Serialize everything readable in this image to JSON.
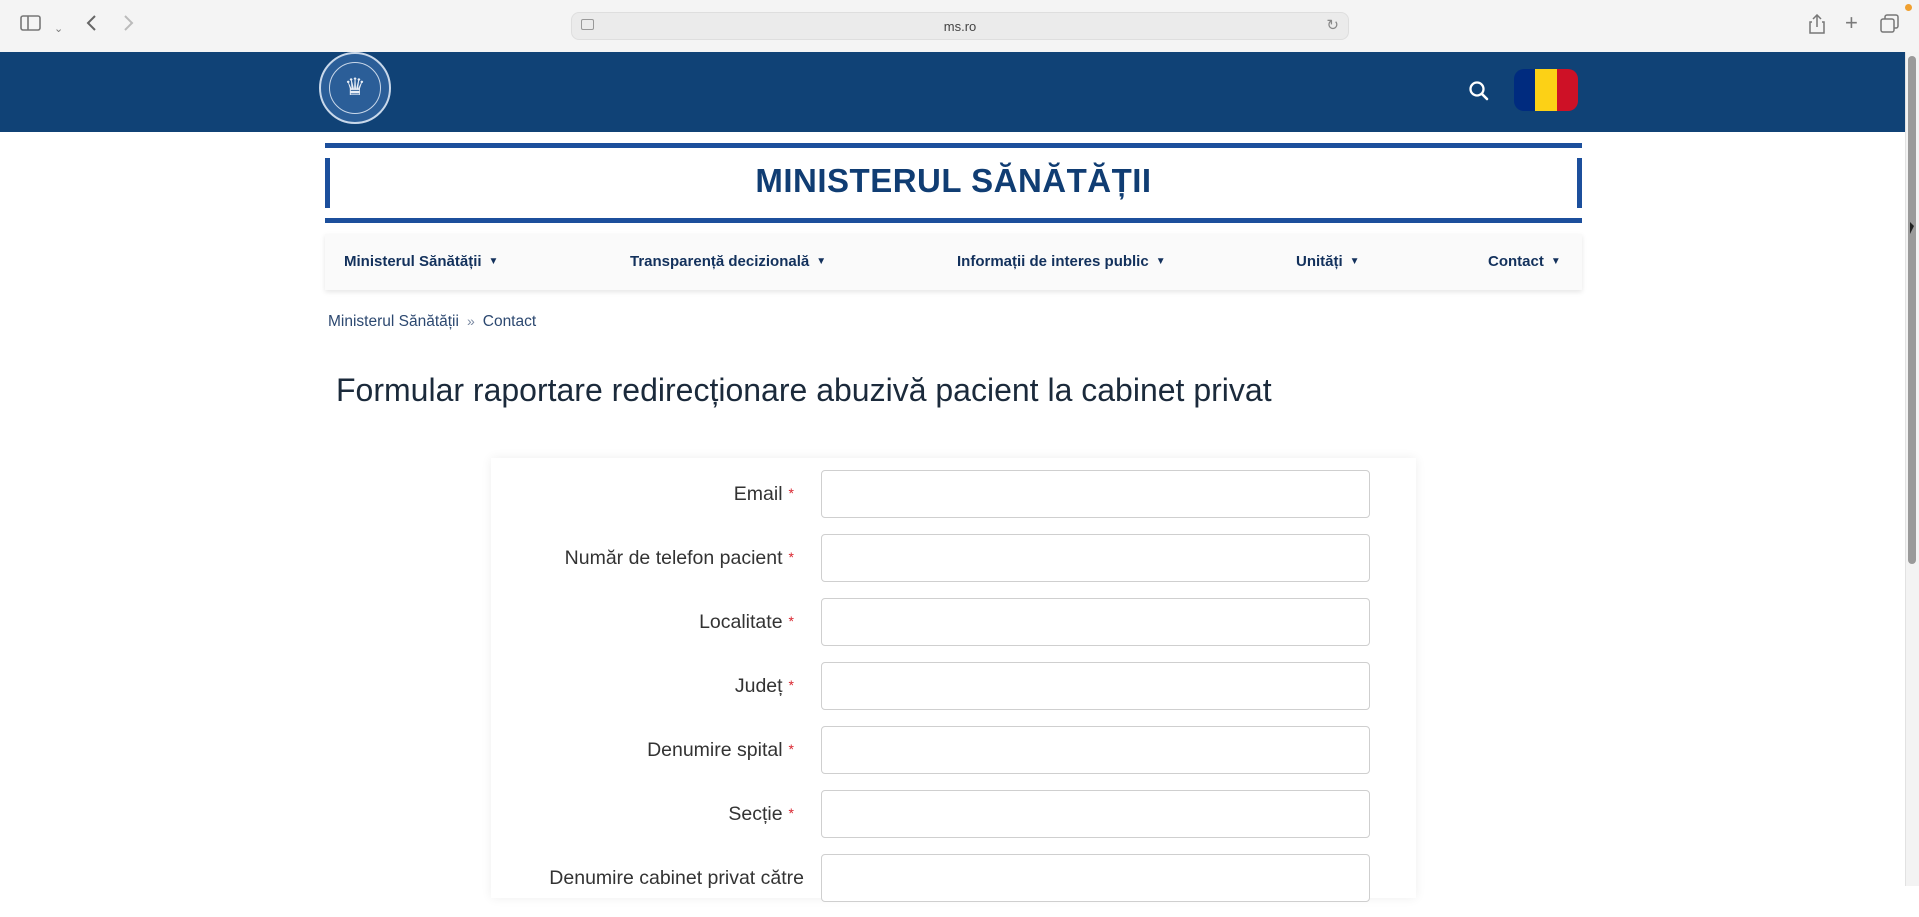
{
  "browser": {
    "url": "ms.ro"
  },
  "header": {
    "flag_colors": [
      "#002B7F",
      "#FCD116",
      "#CE1126"
    ],
    "background": "#104276"
  },
  "site": {
    "title": "MINISTERUL SĂNĂTĂȚII"
  },
  "nav": {
    "items": [
      {
        "label": "Ministerul Sănătății"
      },
      {
        "label": "Transparență decizională"
      },
      {
        "label": "Informații de interes public"
      },
      {
        "label": "Unități"
      },
      {
        "label": "Contact"
      }
    ]
  },
  "breadcrumb": {
    "items": [
      "Ministerul Sănătății",
      "Contact"
    ]
  },
  "page": {
    "title": "Formular raportare redirecționare abuzivă pacient la cabinet privat"
  },
  "form": {
    "required_mark": "*",
    "fields": [
      {
        "label": "Email",
        "value": ""
      },
      {
        "label": "Număr de telefon pacient",
        "value": ""
      },
      {
        "label": "Localitate",
        "value": ""
      },
      {
        "label": "Județ",
        "value": ""
      },
      {
        "label": "Denumire spital",
        "value": ""
      },
      {
        "label": "Secție",
        "value": ""
      },
      {
        "label": "Denumire cabinet privat către",
        "value": ""
      }
    ]
  }
}
